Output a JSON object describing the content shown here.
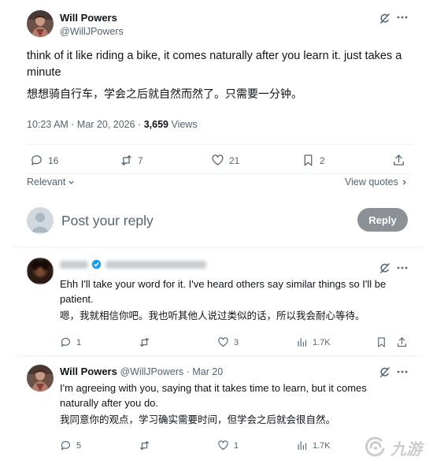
{
  "main_post": {
    "author_name": "Will Powers",
    "author_handle": "@WillJPowers",
    "text_en": "think of it like riding a bike, it comes naturally after you learn it. just takes a minute",
    "text_cn": "想想骑自行车，学会之后就自然而然了。只需要一分钟。",
    "time": "10:23 AM · Mar 20, 2026 · ",
    "views_count": "3,659",
    "views_label": " Views",
    "replies": "16",
    "reposts": "7",
    "likes": "21",
    "bookmarks": "2",
    "relevant_label": "Relevant",
    "view_quotes_label": "View quotes"
  },
  "reply_box": {
    "placeholder": "Post your reply",
    "button_label": "Reply"
  },
  "replies": [
    {
      "text_en": "Ehh I'll take your word for it. I've heard others say similar things so I'll be patient.",
      "text_cn": "嗯，我就相信你吧。我也听其他人说过类似的话，所以我会耐心等待。",
      "replies": "1",
      "reposts": "",
      "likes": "3",
      "views": "1.7K"
    },
    {
      "author_name": "Will Powers",
      "author_meta": "@WillJPowers · Mar 20",
      "text_en": "I'm agreeing with you, saying that it takes time to learn, but it comes naturally after you do.",
      "text_cn": "我同意你的观点，学习确实需要时间，但学会之后就会很自然。",
      "replies": "5",
      "reposts": "",
      "likes": "1",
      "views": "1.7K"
    }
  ],
  "watermark": "九游",
  "colors": {
    "text": "#0f1419",
    "muted": "#536471",
    "verified": "#1d9bf0",
    "reply_button_bg": "#8b9196",
    "divider": "#eff3f4"
  }
}
